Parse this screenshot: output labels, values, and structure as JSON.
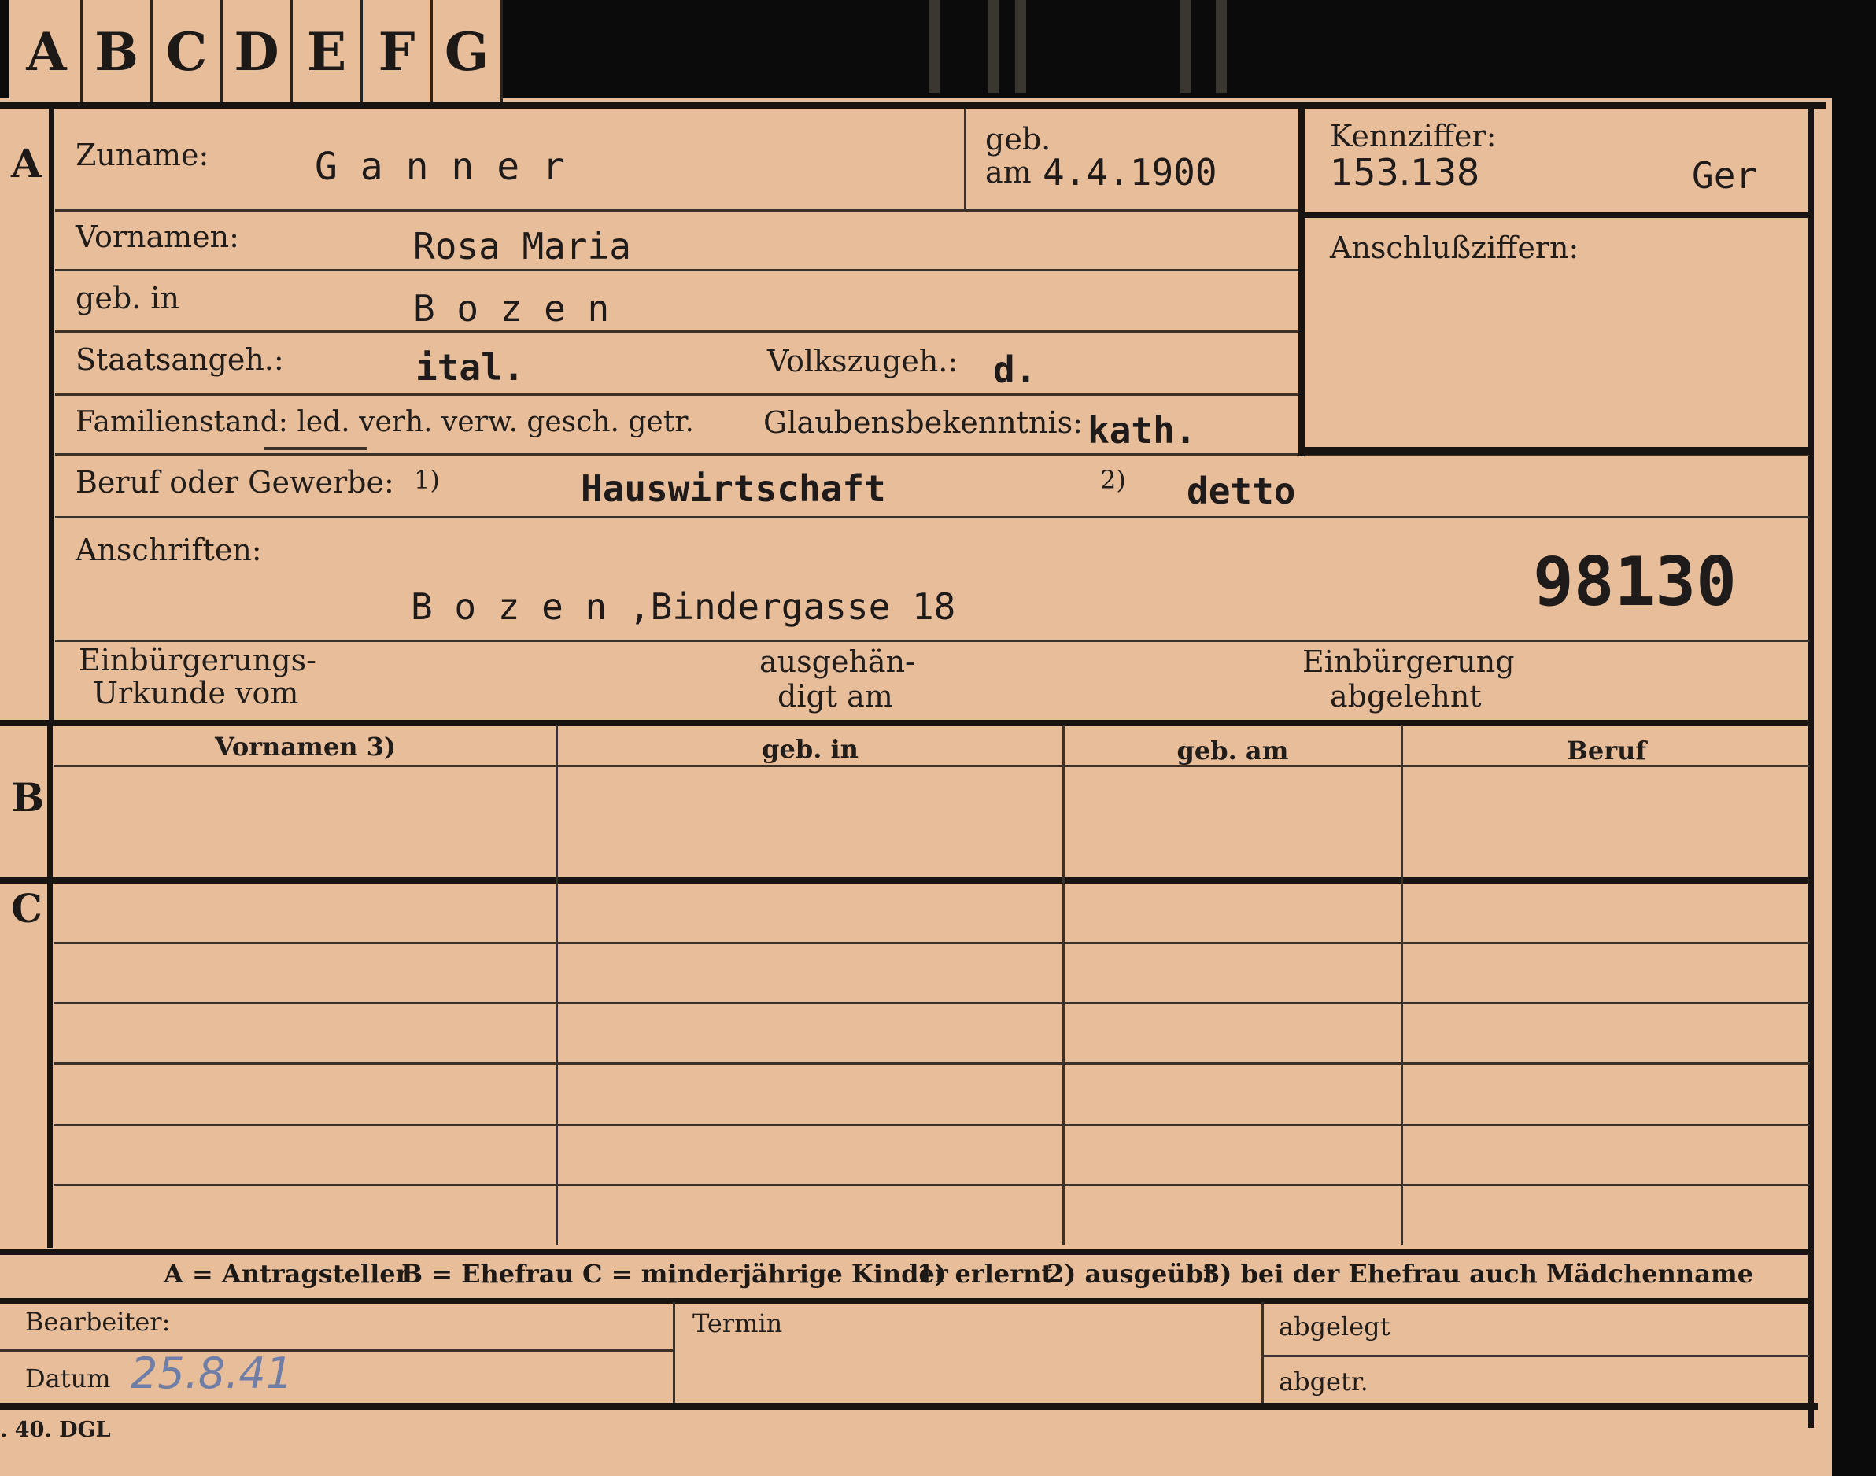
{
  "tabs": [
    "A",
    "B",
    "C",
    "D",
    "E",
    "F",
    "G"
  ],
  "section_letters": {
    "a": "A",
    "b": "B",
    "c": "C"
  },
  "fields": {
    "zuname_label": "Zuname:",
    "zuname_value": "G a n n e r",
    "geb_label": "geb.",
    "geb_am_label": "am",
    "geb_date": "4.4.1900",
    "kennziffer_label": "Kennziffer:",
    "kennziffer_value": "153.138",
    "kennziffer_suffix": "Ger",
    "vornamen_label": "Vornamen:",
    "vornamen_value": "Rosa Maria",
    "anschluss_label": "Anschlußziffern:",
    "gebin_label": "geb. in",
    "gebin_value": "B o z e n",
    "staats_label": "Staatsangeh.:",
    "staats_value": "ital.",
    "volks_label": "Volkszugeh.:",
    "volks_value": "d.",
    "familien_label": "Familienstand: led. verh. verw. gesch. getr.",
    "glaubens_label": "Glaubensbekenntnis:",
    "glaubens_value": "kath.",
    "beruf_label": "Beruf oder Gewerbe:",
    "beruf_m1": "1)",
    "beruf_value1": "Hauswirtschaft",
    "beruf_m2": "2)",
    "beruf_value2": "detto",
    "anschriften_label": "Anschriften:",
    "anschriften_value": "B o z e n ,Bindergasse 18",
    "stamp_number": "98130",
    "einb_urk_l1": "Einbürgerungs-",
    "einb_urk_l2": "Urkunde vom",
    "ausgeh_l1": "ausgehän-",
    "ausgeh_l2": "digt am",
    "einb_abg_l1": "Einbürgerung",
    "einb_abg_l2": "abgelehnt"
  },
  "table_headers": [
    "Vornamen 3)",
    "geb. in",
    "geb. am",
    "Beruf"
  ],
  "legend": {
    "a": "A = Antragsteller",
    "b": "B = Ehefrau",
    "c": "C = minderjährige Kinder",
    "n1": "1) erlernt",
    "n2": "2) ausgeübt",
    "n3": "3) bei der Ehefrau auch Mädchenname"
  },
  "footer": {
    "bearbeiter": "Bearbeiter:",
    "datum_label": "Datum",
    "datum_value": "25.8.41",
    "termin": "Termin",
    "abgelegt": "abgelegt",
    "abgetr": "abgetr.",
    "print_code": ". 40. DGL"
  },
  "colors": {
    "card": "#e8bd9a",
    "ink": "#211d1b",
    "pencil": "#6f7ea6"
  }
}
